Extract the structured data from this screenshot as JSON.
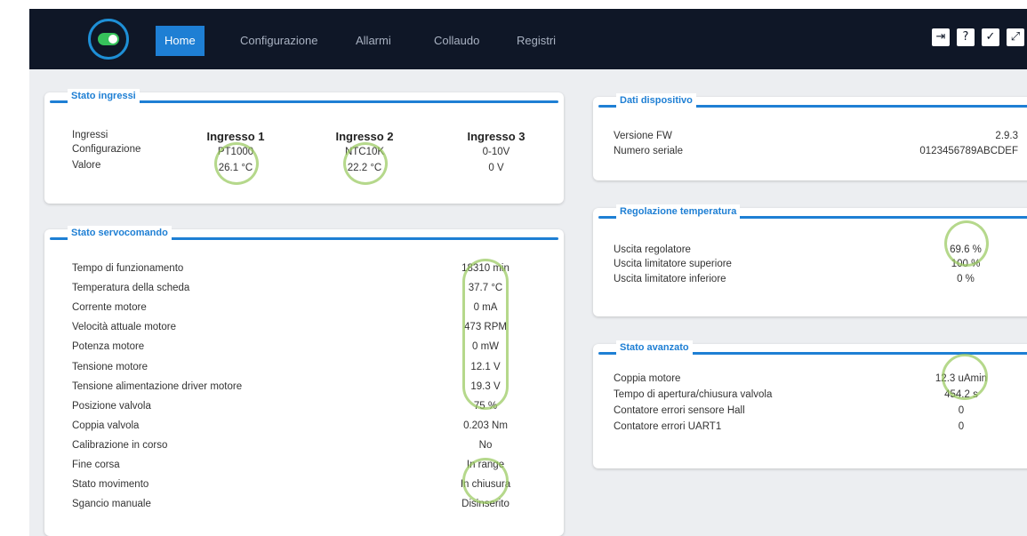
{
  "nav": {
    "items": [
      "Home",
      "Configurazione",
      "Allarmi",
      "Collaudo",
      "Registri"
    ],
    "active": "Home",
    "icons": [
      "exit-icon",
      "help-icon",
      "check-icon",
      "fullscreen-icon"
    ]
  },
  "colors": {
    "navbar": "#0f1727",
    "accent": "#1e7fd4",
    "toggle": "#36c25b",
    "highlight_ring": "#96c85a"
  },
  "inputs": {
    "title": "Stato ingressi",
    "row_labels": [
      "Ingressi",
      "Configurazione",
      "Valore"
    ],
    "columns": [
      {
        "name": "Ingresso 1",
        "config": "PT1000",
        "value": "26.1 °C"
      },
      {
        "name": "Ingresso 2",
        "config": "NTC10K",
        "value": "22.2 °C"
      },
      {
        "name": "Ingresso 3",
        "config": "0-10V",
        "value": "0 V"
      }
    ]
  },
  "actuator": {
    "title": "Stato servocomando",
    "rows": [
      {
        "label": "Tempo di funzionamento",
        "value": "18310 min"
      },
      {
        "label": "Temperatura della scheda",
        "value": "37.7 °C"
      },
      {
        "label": "Corrente motore",
        "value": "0 mA"
      },
      {
        "label": "Velocità attuale motore",
        "value": "473 RPM"
      },
      {
        "label": "Potenza motore",
        "value": "0 mW"
      },
      {
        "label": "Tensione motore",
        "value": "12.1 V"
      },
      {
        "label": "Tensione alimentazione driver motore",
        "value": "19.3 V"
      },
      {
        "label": "Posizione valvola",
        "value": "75 %"
      },
      {
        "label": "Coppia valvola",
        "value": "0.203 Nm"
      },
      {
        "label": "Calibrazione in corso",
        "value": "No"
      },
      {
        "label": "Fine corsa",
        "value": "In range"
      },
      {
        "label": "Stato movimento",
        "value": "In chiusura"
      },
      {
        "label": "Sgancio manuale",
        "value": "Disinserito"
      }
    ]
  },
  "device": {
    "title": "Dati dispositivo",
    "rows": [
      {
        "label": "Versione FW",
        "value": "2.9.3"
      },
      {
        "label": "Numero seriale",
        "value": "0123456789ABCDEF"
      }
    ]
  },
  "regulation": {
    "title": "Regolazione temperatura",
    "rows": [
      {
        "label": "Uscita regolatore",
        "value": "69.6 %"
      },
      {
        "label": "Uscita limitatore superiore",
        "value": "100 %"
      },
      {
        "label": "Uscita limitatore inferiore",
        "value": "0 %"
      }
    ]
  },
  "advanced": {
    "title": "Stato avanzato",
    "rows": [
      {
        "label": "Coppia motore",
        "value": "12.3 uAmin"
      },
      {
        "label": "Tempo di apertura/chiusura valvola",
        "value": "454.2 s"
      },
      {
        "label": "Contatore errori sensore Hall",
        "value": "0"
      },
      {
        "label": "Contatore errori UART1",
        "value": "0"
      }
    ]
  }
}
